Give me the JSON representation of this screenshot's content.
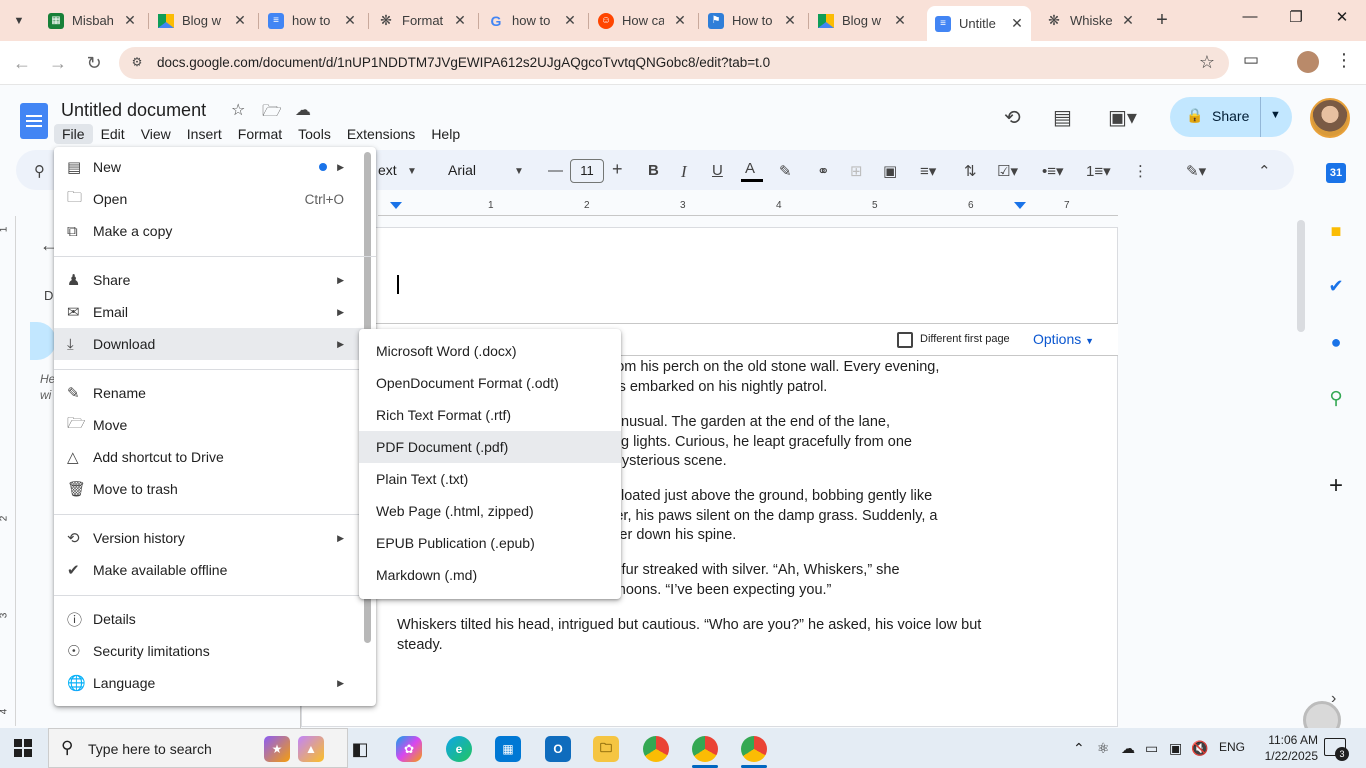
{
  "browser": {
    "tabs": [
      {
        "label": "Misbah",
        "favicon": "sheets-icon",
        "color": "#188038"
      },
      {
        "label": "Blog w",
        "favicon": "drive-icon",
        "color": "#fbbc04"
      },
      {
        "label": "how to",
        "favicon": "docs-icon",
        "color": "#4285f4"
      },
      {
        "label": "Format",
        "favicon": "openai-icon",
        "color": "#444444"
      },
      {
        "label": "how to",
        "favicon": "google-icon",
        "color": "#4285f4"
      },
      {
        "label": "How ca",
        "favicon": "reddit-icon",
        "color": "#ff4500"
      },
      {
        "label": "How to",
        "favicon": "bookmark-icon",
        "color": "#2f7ed8"
      },
      {
        "label": "Blog w",
        "favicon": "drive-icon",
        "color": "#fbbc04"
      },
      {
        "label": "Untitle",
        "favicon": "docs-icon",
        "color": "#4285f4",
        "active": true
      },
      {
        "label": "Whiske",
        "favicon": "openai-icon",
        "color": "#444444"
      }
    ],
    "url": "docs.google.com/document/d/1nUP1NDDTM7JVgEWIPA612s2UJgAQgcoTvvtqQNGobc8/edit?tab=t.0"
  },
  "docs": {
    "title": "Untitled document",
    "menubar": [
      "File",
      "Edit",
      "View",
      "Insert",
      "Format",
      "Tools",
      "Extensions",
      "Help"
    ],
    "share_label": "Share",
    "accent_color": "#c2e7ff"
  },
  "format_toolbar": {
    "style_partial": "ext",
    "font": "Arial",
    "font_size": "11"
  },
  "ruler": {
    "numbers": [
      "1",
      "2",
      "3",
      "4",
      "5",
      "6",
      "7"
    ]
  },
  "left_panel": {
    "back_partial": "D",
    "hint_line1": "He",
    "hint_line2": "wi"
  },
  "header_options": {
    "different_first_page": "Different first page",
    "options": "Options"
  },
  "document": {
    "paragraphs": [
      {
        "line1": "                                    nborhood from his perch on the old stone wall. Every evening,",
        "line2": "                                    on, Whiskers embarked on his nightly patrol."
      },
      {
        "line1": "                                    something unusual. The garden at the end of the lane,",
        "line2": "                                    with flickering lights. Curious, he leapt gracefully from one",
        "line3": "                                    ached the mysterious scene."
      },
      {
        "line1": "                                    r. Tiny orbs floated just above the ground, bobbing gently like",
        "line2": "                                    s crept closer, his paws silent on the damp grass. Suddenly, a",
        "line3": "                                    nding a shiver down his spine."
      },
      {
        "line1": "                                    d tabby, her fur streaked with silver. “Ah, Whiskers,” she",
        "line2": "                                    ht of many moons. “I’ve been expecting you.”"
      },
      {
        "line1": "Whiskers tilted his head, intrigued but cautious. “Who are you?” he asked, his voice low but",
        "line2": "steady."
      }
    ]
  },
  "file_menu": {
    "items": [
      {
        "label": "New",
        "icon": "new-doc-icon",
        "has_dot": true,
        "submenu": true
      },
      {
        "label": "Open",
        "icon": "folder-icon",
        "shortcut": "Ctrl+O"
      },
      {
        "label": "Make a copy",
        "icon": "copy-icon"
      },
      {
        "label": "Share",
        "icon": "share-person-icon",
        "submenu": true
      },
      {
        "label": "Email",
        "icon": "email-icon",
        "submenu": true
      },
      {
        "label": "Download",
        "icon": "download-icon",
        "submenu": true,
        "highlighted": true
      },
      {
        "label": "Rename",
        "icon": "rename-icon"
      },
      {
        "label": "Move",
        "icon": "move-folder-icon"
      },
      {
        "label": "Add shortcut to Drive",
        "icon": "drive-shortcut-icon"
      },
      {
        "label": "Move to trash",
        "icon": "trash-icon"
      },
      {
        "label": "Version history",
        "icon": "history-icon",
        "submenu": true
      },
      {
        "label": "Make available offline",
        "icon": "offline-icon"
      },
      {
        "label": "Details",
        "icon": "info-icon"
      },
      {
        "label": "Security limitations",
        "icon": "security-icon"
      },
      {
        "label": "Language",
        "icon": "globe-icon",
        "submenu": true
      }
    ]
  },
  "download_menu": {
    "items": [
      "Microsoft Word (.docx)",
      "OpenDocument Format (.odt)",
      "Rich Text Format (.rtf)",
      "PDF Document (.pdf)",
      "Plain Text (.txt)",
      "Web Page (.html, zipped)",
      "EPUB Publication (.epub)",
      "Markdown (.md)"
    ],
    "highlighted": "PDF Document (.pdf)"
  },
  "taskbar": {
    "search_placeholder": "Type here to search",
    "lang": "ENG",
    "time": "11:06 AM",
    "date": "1/22/2025",
    "notifications": "3"
  }
}
